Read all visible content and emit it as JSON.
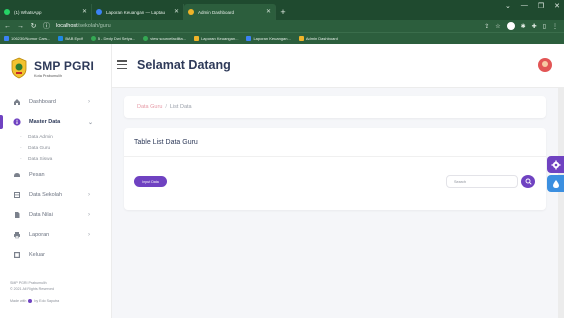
{
  "browser": {
    "tabs": [
      {
        "title": "(1) WhatsApp",
        "active": false,
        "favicon_color": "#25d366"
      },
      {
        "title": "Laporan Keuangan — Laptau",
        "active": false,
        "favicon_color": "#3b82f6"
      },
      {
        "title": "Admin Dashboard",
        "active": true,
        "favicon_color": "#f0b429"
      }
    ],
    "url": {
      "host": "localhost",
      "path": "/sekolah/guru"
    },
    "bookmarks": [
      {
        "label": "106230/Nomor Cars...",
        "color": "#3b82f6"
      },
      {
        "label": "BAB Epdf",
        "color": "#1e88e5"
      },
      {
        "label": "5 - Dedy Dwi Setya...",
        "color": "#34a853"
      },
      {
        "label": "view sourcefacilita...",
        "color": "#34a853"
      },
      {
        "label": "Laporan Keuangan...",
        "color": "#f0b429"
      },
      {
        "label": "Laporan Keuangan...",
        "color": "#3b82f6"
      },
      {
        "label": "Admin Dashboard",
        "color": "#f0b429"
      }
    ]
  },
  "brand": {
    "name": "SMP PGRI",
    "subtitle": "Kota Prabumulih"
  },
  "sidebar": {
    "items": [
      {
        "label": "Dashboard",
        "icon": "home-icon",
        "chevron": true,
        "active": false
      },
      {
        "label": "Master Data",
        "icon": "info-icon",
        "chevron": true,
        "active": true
      },
      {
        "label": "Pesan",
        "icon": "message-icon",
        "chevron": false,
        "active": false
      },
      {
        "label": "Data Sekolah",
        "icon": "table-icon",
        "chevron": true,
        "active": false
      },
      {
        "label": "Data Nilai",
        "icon": "document-icon",
        "chevron": true,
        "active": false
      },
      {
        "label": "Laporan",
        "icon": "print-icon",
        "chevron": true,
        "active": false
      },
      {
        "label": "Keluar",
        "icon": "logout-icon",
        "chevron": false,
        "active": false
      }
    ],
    "submenu": [
      "Data Admin",
      "Data Guru",
      "Data Siswa"
    ],
    "footer": {
      "line1": "SMP PGRI Prabumulih",
      "line2": "© 2021 All Rights Reserved",
      "made": "Made with",
      "by": "by Edo Saputra"
    }
  },
  "header": {
    "title": "Selamat Datang"
  },
  "breadcrumb": {
    "link": "Data Guru",
    "separator": "/",
    "current": "List Data"
  },
  "card": {
    "title": "Table List Data Guru",
    "button_label": "Input Data",
    "search_placeholder": "Search"
  },
  "colors": {
    "accent": "#6f42c1",
    "secondary": "#3b8fe0",
    "breadcrumb_link": "#e69aa6"
  },
  "floating": [
    {
      "icon": "gear-icon"
    },
    {
      "icon": "drop-icon"
    }
  ]
}
